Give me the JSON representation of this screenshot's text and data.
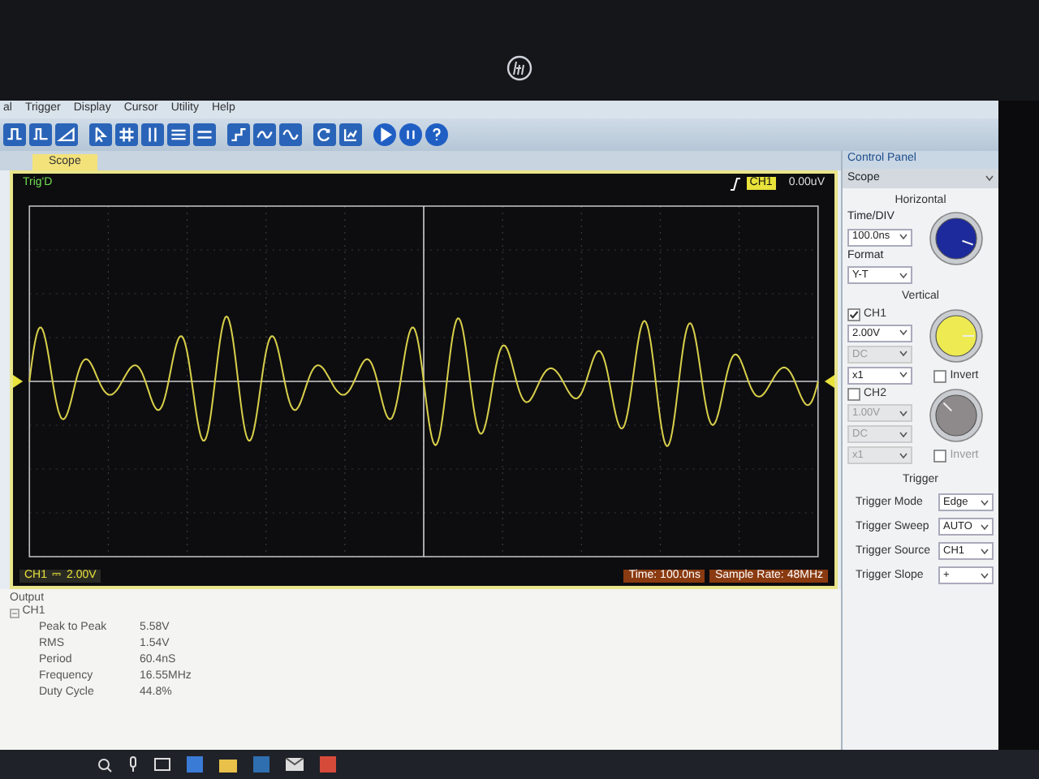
{
  "menu": [
    {
      "label": "al"
    },
    {
      "label": "Trigger"
    },
    {
      "label": "Display"
    },
    {
      "label": "Cursor"
    },
    {
      "label": "Utility"
    },
    {
      "label": "Help"
    }
  ],
  "tabs": [
    {
      "label": "Scope",
      "selected": true
    }
  ],
  "scope": {
    "status": "Trig'D",
    "trigger_channel": "CH1",
    "trigger_level": "0.00uV",
    "channel_label": "CH1",
    "coupling_symbol": "⎓",
    "channel_scale": "2.00V",
    "time": "Time: 100.0ns",
    "sample_rate": "Sample Rate: 48MHz"
  },
  "control_panel": {
    "title": "Control Panel",
    "view": "Scope",
    "horizontal": {
      "title": "Horizontal",
      "time_div_label": "Time/DIV",
      "time_div": "100.0ns",
      "format_label": "Format",
      "format": "Y-T"
    },
    "vertical": {
      "title": "Vertical",
      "channels": [
        {
          "label": "CH1",
          "checked": true,
          "scale": {
            "value": "2.00V",
            "disabled": false
          },
          "coupling": {
            "value": "DC",
            "disabled": true
          },
          "probe": {
            "value": "x1",
            "disabled": false
          },
          "invert": {
            "label": "Invert",
            "checked": false,
            "disabled": false
          }
        },
        {
          "label": "CH2",
          "checked": false,
          "scale": {
            "value": "1.00V",
            "disabled": true
          },
          "coupling": {
            "value": "DC",
            "disabled": true
          },
          "probe": {
            "value": "x1",
            "disabled": true
          },
          "invert": {
            "label": "Invert",
            "checked": false,
            "disabled": true
          }
        }
      ]
    },
    "trigger": {
      "title": "Trigger",
      "rows": [
        {
          "label": "Trigger Mode",
          "value": "Edge"
        },
        {
          "label": "Trigger Sweep",
          "value": "AUTO"
        },
        {
          "label": "Trigger Source",
          "value": "CH1"
        },
        {
          "label": "Trigger Slope",
          "value": "+"
        }
      ]
    }
  },
  "output": {
    "title": "Output",
    "tree": [
      {
        "label": "CH1",
        "expanded": true,
        "children": [
          {
            "label": "Peak to Peak",
            "value": "5.58V"
          },
          {
            "label": "RMS",
            "value": "1.54V"
          },
          {
            "label": "Period",
            "value": "60.4nS"
          },
          {
            "label": "Frequency",
            "value": "16.55MHz"
          },
          {
            "label": "Duty Cycle",
            "value": "44.8%"
          }
        ]
      }
    ]
  }
}
